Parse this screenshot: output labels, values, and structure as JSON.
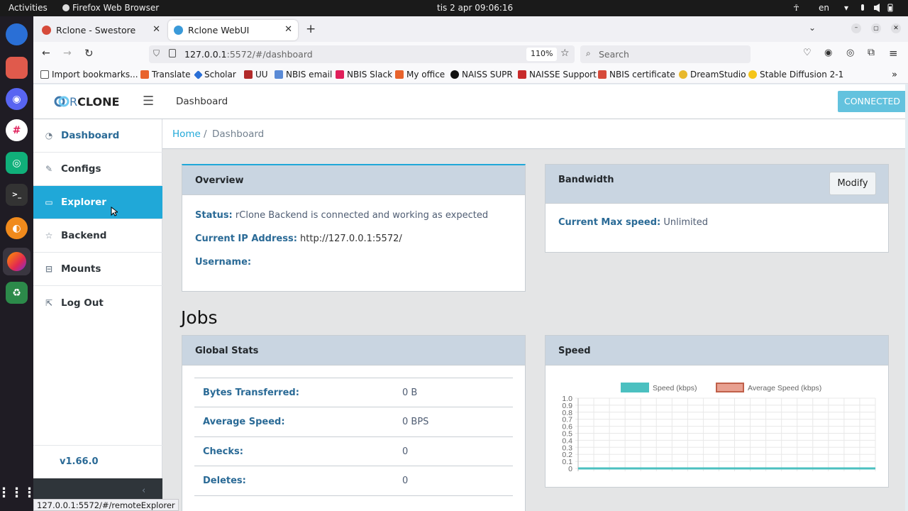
{
  "os": {
    "activities": "Activities",
    "app_name": "Firefox Web Browser",
    "clock": "tis 2 apr  09:06:16",
    "lang": "en"
  },
  "browser": {
    "tabs": [
      {
        "label": "Rclone - Swestore",
        "active": false
      },
      {
        "label": "Rclone WebUI",
        "active": true
      }
    ],
    "url_host": "127.0.0.1",
    "url_rest": ":5572/#/dashboard",
    "zoom": "110%",
    "search_placeholder": "Search",
    "bookmarks": [
      "Import bookmarks...",
      "Translate",
      "Scholar",
      "UU",
      "NBIS email",
      "NBIS Slack",
      "My office",
      "NAISS SUPR",
      "NAISSE Support",
      "NBIS certificate",
      "DreamStudio",
      "Stable Diffusion 2-1"
    ],
    "status_url": "127.0.0.1:5572/#/remoteExplorer"
  },
  "app": {
    "logo_r": "R",
    "logo_rest": "CLONE",
    "header_title": "Dashboard",
    "connected": "CONNECTED",
    "version": "v1.66.0",
    "nav": [
      {
        "label": "Dashboard",
        "icon": "gauge-icon"
      },
      {
        "label": "Configs",
        "icon": "edit-icon"
      },
      {
        "label": "Explorer",
        "icon": "monitor-icon"
      },
      {
        "label": "Backend",
        "icon": "star-icon"
      },
      {
        "label": "Mounts",
        "icon": "drive-icon"
      },
      {
        "label": "Log Out",
        "icon": "logout-icon"
      }
    ],
    "breadcrumb": {
      "home": "Home",
      "sep": "/",
      "current": "Dashboard"
    }
  },
  "overview": {
    "title": "Overview",
    "status_label": "Status:",
    "status_value": "rClone Backend is connected and working as expected",
    "ip_label": "Current IP Address:",
    "ip_value": "http://127.0.0.1:5572/",
    "username_label": "Username:"
  },
  "bandwidth": {
    "title": "Bandwidth",
    "modify": "Modify",
    "speed_label": "Current Max speed:",
    "speed_value": "Unlimited"
  },
  "jobs": {
    "heading": "Jobs",
    "global_title": "Global Stats",
    "stats": [
      {
        "label": "Bytes Transferred:",
        "value": "0 B"
      },
      {
        "label": "Average Speed:",
        "value": "0 BPS"
      },
      {
        "label": "Checks:",
        "value": "0"
      },
      {
        "label": "Deletes:",
        "value": "0"
      }
    ],
    "speed_title": "Speed"
  },
  "chart_data": {
    "type": "line",
    "series": [
      {
        "name": "Speed (kbps)",
        "color": "#4bc0c0",
        "values": [
          0,
          0,
          0,
          0,
          0,
          0,
          0,
          0,
          0,
          0,
          0,
          0,
          0,
          0,
          0,
          0,
          0,
          0,
          0,
          0
        ]
      },
      {
        "name": "Average Speed (kbps)",
        "color": "#e8a090",
        "values": [
          0,
          0,
          0,
          0,
          0,
          0,
          0,
          0,
          0,
          0,
          0,
          0,
          0,
          0,
          0,
          0,
          0,
          0,
          0,
          0
        ]
      }
    ],
    "yticks": [
      "0",
      "0.1",
      "0.2",
      "0.3",
      "0.4",
      "0.5",
      "0.6",
      "0.7",
      "0.8",
      "0.9",
      "1.0"
    ],
    "ylim": [
      0,
      1.0
    ],
    "grid": true,
    "legend": "top"
  }
}
